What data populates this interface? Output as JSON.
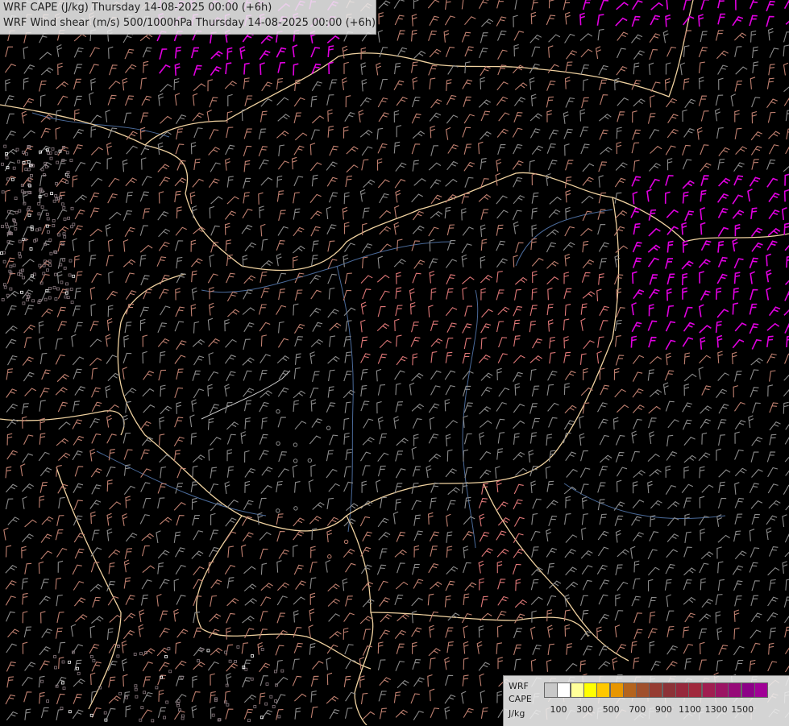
{
  "titles": {
    "line1": "WRF CAPE (J/kg) Thursday 14-08-2025 00:00 (+6h)",
    "line2": "WRF Wind shear (m/s) 500/1000hPa Thursday 14-08-2025 00:00 (+6h)"
  },
  "legend": {
    "label_line1": "WRF",
    "label_line2": "CAPE",
    "label_line3": "J/kg",
    "swatch_colors": [
      "#c8c8c8",
      "#ffffff",
      "#ffff9a",
      "#ffff00",
      "#ffc800",
      "#e79600",
      "#b4641e",
      "#a0502d",
      "#963c32",
      "#8c3237",
      "#96283c",
      "#a0283c",
      "#a01e50",
      "#9b1464",
      "#960a78",
      "#8c0087",
      "#a00096"
    ],
    "tick_labels": [
      "100",
      "300",
      "500",
      "700",
      "900",
      "1100",
      "1300",
      "1500"
    ]
  },
  "map_colors": {
    "background": "#000000",
    "border": "#f0d2a0",
    "river": "#4a6a9a",
    "barb_weak": "#8c8c8c",
    "barb_mid": "#c08070",
    "barb_strong": "#e07878",
    "barb_extreme": "#e000e0"
  }
}
